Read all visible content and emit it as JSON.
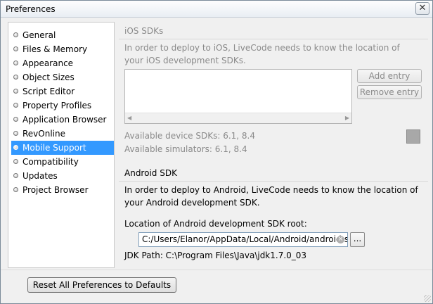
{
  "window": {
    "title": "Preferences",
    "close_symbol": "✕"
  },
  "sidebar": {
    "items": [
      {
        "label": "General",
        "selected": false
      },
      {
        "label": "Files & Memory",
        "selected": false
      },
      {
        "label": "Appearance",
        "selected": false
      },
      {
        "label": "Object Sizes",
        "selected": false
      },
      {
        "label": "Script Editor",
        "selected": false
      },
      {
        "label": "Property Profiles",
        "selected": false
      },
      {
        "label": "Application Browser",
        "selected": false
      },
      {
        "label": "RevOnline",
        "selected": false
      },
      {
        "label": "Mobile Support",
        "selected": true
      },
      {
        "label": "Compatibility",
        "selected": false
      },
      {
        "label": "Updates",
        "selected": false
      },
      {
        "label": "Project Browser",
        "selected": false
      }
    ]
  },
  "ios": {
    "title": "iOS SDKs",
    "description": "In order to deploy to iOS, LiveCode needs to know the location of your iOS development SDKs.",
    "add_entry": "Add entry",
    "remove_entry": "Remove entry",
    "available_device": "Available device SDKs: 6.1, 8.4",
    "available_simulators": "Available simulators: 6.1, 8.4",
    "swatch_color": "#a8a8a8"
  },
  "android": {
    "title": "Android SDK",
    "description": "In order to deploy to Android, LiveCode needs to know the location of your Android development SDK.",
    "location_label": "Location of Android development SDK root:",
    "sdk_path": "C:/Users/Elanor/AppData/Local/Android/android-sd",
    "browse_label": "...",
    "jdk_path": "JDK Path: C:\\Program Files\\Java\\jdk1.7.0_03"
  },
  "footer": {
    "reset_label": "Reset All Preferences to Defaults"
  },
  "colors": {
    "selection": "#3399ff",
    "disabled_text": "#8a8a8a"
  }
}
